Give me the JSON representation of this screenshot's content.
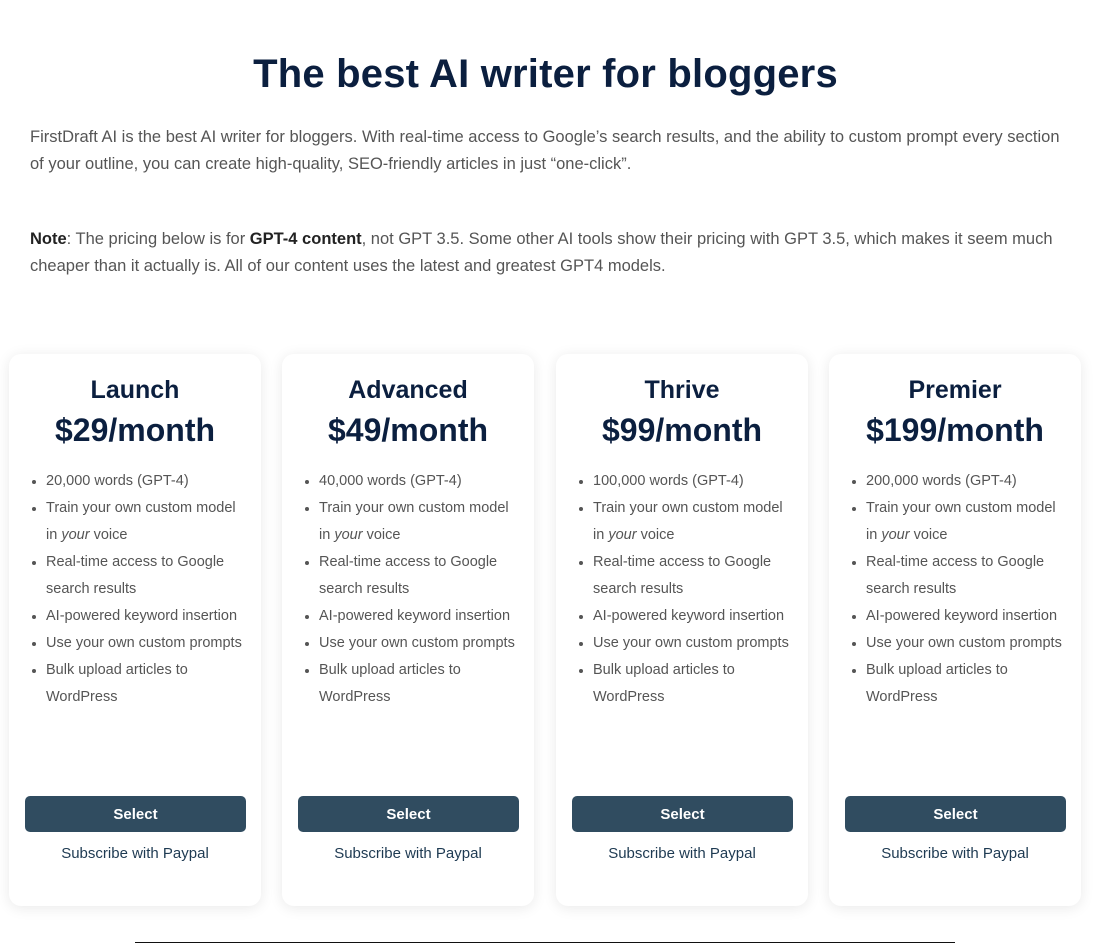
{
  "header": {
    "title": "The best AI writer for bloggers"
  },
  "intro": {
    "text": "FirstDraft AI is the best AI writer for bloggers. With real-time access to Google’s search results, and the ability to custom prompt every section of your outline, you can create high-quality, SEO-friendly articles in just “one-click”."
  },
  "note": {
    "label": "Note",
    "part1": ": The pricing below is for ",
    "bold": "GPT-4 content",
    "part2": ", not GPT 3.5. Some other AI tools show their pricing with GPT 3.5, which makes it seem much cheaper than it actually is. All of our content uses the latest and greatest GPT4 models."
  },
  "plans": [
    {
      "name": "Launch",
      "price": "$29/month",
      "words": "20,000 words (GPT-4)",
      "features": {
        "train_pre": "Train your own custom model in ",
        "train_em": "your",
        "train_post": " voice",
        "realtime": "Real-time access to Google search results",
        "keyword": "AI-powered keyword insertion",
        "prompts": "Use your own custom prompts",
        "bulk": "Bulk upload articles to WordPress"
      },
      "select_label": "Select",
      "paypal_label": "Subscribe with Paypal"
    },
    {
      "name": "Advanced",
      "price": "$49/month",
      "words": "40,000 words (GPT-4)",
      "features": {
        "train_pre": "Train your own custom model in ",
        "train_em": "your",
        "train_post": " voice",
        "realtime": "Real-time access to Google search results",
        "keyword": "AI-powered keyword insertion",
        "prompts": "Use your own custom prompts",
        "bulk": "Bulk upload articles to WordPress"
      },
      "select_label": "Select",
      "paypal_label": "Subscribe with Paypal"
    },
    {
      "name": "Thrive",
      "price": "$99/month",
      "words": "100,000 words (GPT-4)",
      "features": {
        "train_pre": "Train your own custom model in ",
        "train_em": "your",
        "train_post": " voice",
        "realtime": "Real-time access to Google search results",
        "keyword": "AI-powered keyword insertion",
        "prompts": "Use your own custom prompts",
        "bulk": "Bulk upload articles to WordPress"
      },
      "select_label": "Select",
      "paypal_label": "Subscribe with Paypal"
    },
    {
      "name": "Premier",
      "price": "$199/month",
      "words": "200,000 words (GPT-4)",
      "features": {
        "train_pre": "Train your own custom model in ",
        "train_em": "your",
        "train_post": " voice",
        "realtime": "Real-time access to Google search results",
        "keyword": "AI-powered keyword insertion",
        "prompts": "Use your own custom prompts",
        "bulk": "Bulk upload articles to WordPress"
      },
      "select_label": "Select",
      "paypal_label": "Subscribe with Paypal"
    }
  ],
  "colors": {
    "heading": "#0b1f3f",
    "body_text": "#555555",
    "button_bg": "#304c60",
    "button_text": "#ffffff",
    "link": "#1e3a52"
  }
}
